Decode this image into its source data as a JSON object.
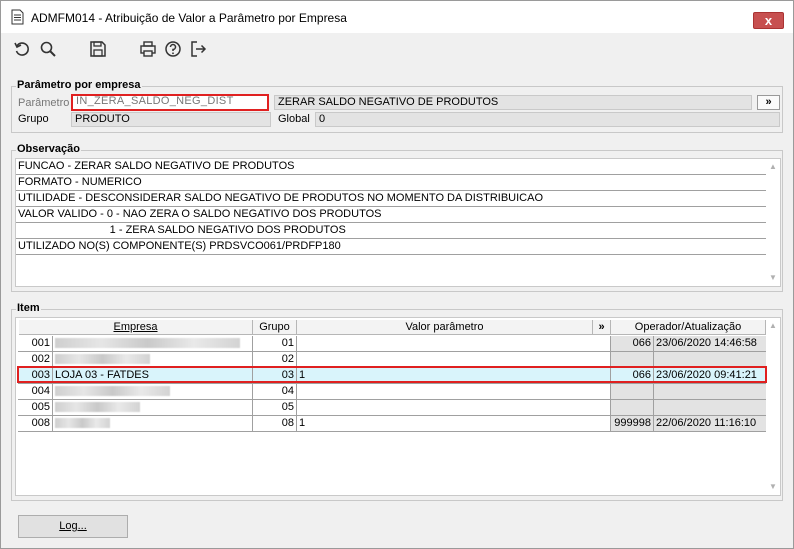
{
  "window": {
    "title": "ADMFM014 - Atribuição de Valor a Parâmetro por Empresa",
    "close_label": "x"
  },
  "toolbar": {
    "icons": [
      "undo-icon",
      "search-icon",
      "save-icon",
      "print-icon",
      "help-icon",
      "exit-icon"
    ]
  },
  "param_section": {
    "title": "Parâmetro por empresa",
    "param_label": "Parâmetro",
    "param_value": "IN_ZERA_SALDO_NEG_DIST",
    "param_desc": "ZERAR SALDO NEGATIVO DE PRODUTOS",
    "more_label": "»",
    "group_label": "Grupo",
    "group_value": "PRODUTO",
    "global_label": "Global",
    "global_value": "0"
  },
  "obs_section": {
    "title": "Observação",
    "lines": [
      "FUNCAO - ZERAR SALDO NEGATIVO DE PRODUTOS",
      "FORMATO - NUMERICO",
      "UTILIDADE - DESCONSIDERAR SALDO NEGATIVO DE PRODUTOS NO MOMENTO DA DISTRIBUICAO",
      "VALOR VALIDO - 0 - NAO ZERA O SALDO NEGATIVO DOS PRODUTOS",
      "                              1 - ZERA SALDO NEGATIVO DOS PRODUTOS",
      "UTILIZADO NO(S) COMPONENTE(S) PRDSVCO061/PRDFP180"
    ]
  },
  "item_section": {
    "title": "Item",
    "columns": {
      "empresa": "Empresa",
      "grupo": "Grupo",
      "valor": "Valor parâmetro",
      "more": "»",
      "operador": "Operador/Atualização"
    },
    "rows": [
      {
        "code": "001",
        "name": "",
        "grupo": "01",
        "valor": "",
        "op": "066",
        "date": "23/06/2020 14:46:58"
      },
      {
        "code": "002",
        "name": "",
        "grupo": "02",
        "valor": "",
        "op": "",
        "date": ""
      },
      {
        "code": "003",
        "name": "LOJA 03 - FATDES",
        "grupo": "03",
        "valor": "1",
        "op": "066",
        "date": "23/06/2020 09:41:21"
      },
      {
        "code": "004",
        "name": "",
        "grupo": "04",
        "valor": "",
        "op": "",
        "date": ""
      },
      {
        "code": "005",
        "name": "",
        "grupo": "05",
        "valor": "",
        "op": "",
        "date": ""
      },
      {
        "code": "008",
        "name": "",
        "grupo": "08",
        "valor": "1",
        "op": "999998",
        "date": "22/06/2020 11:16:10"
      }
    ]
  },
  "footer": {
    "log_label": "Log..."
  }
}
